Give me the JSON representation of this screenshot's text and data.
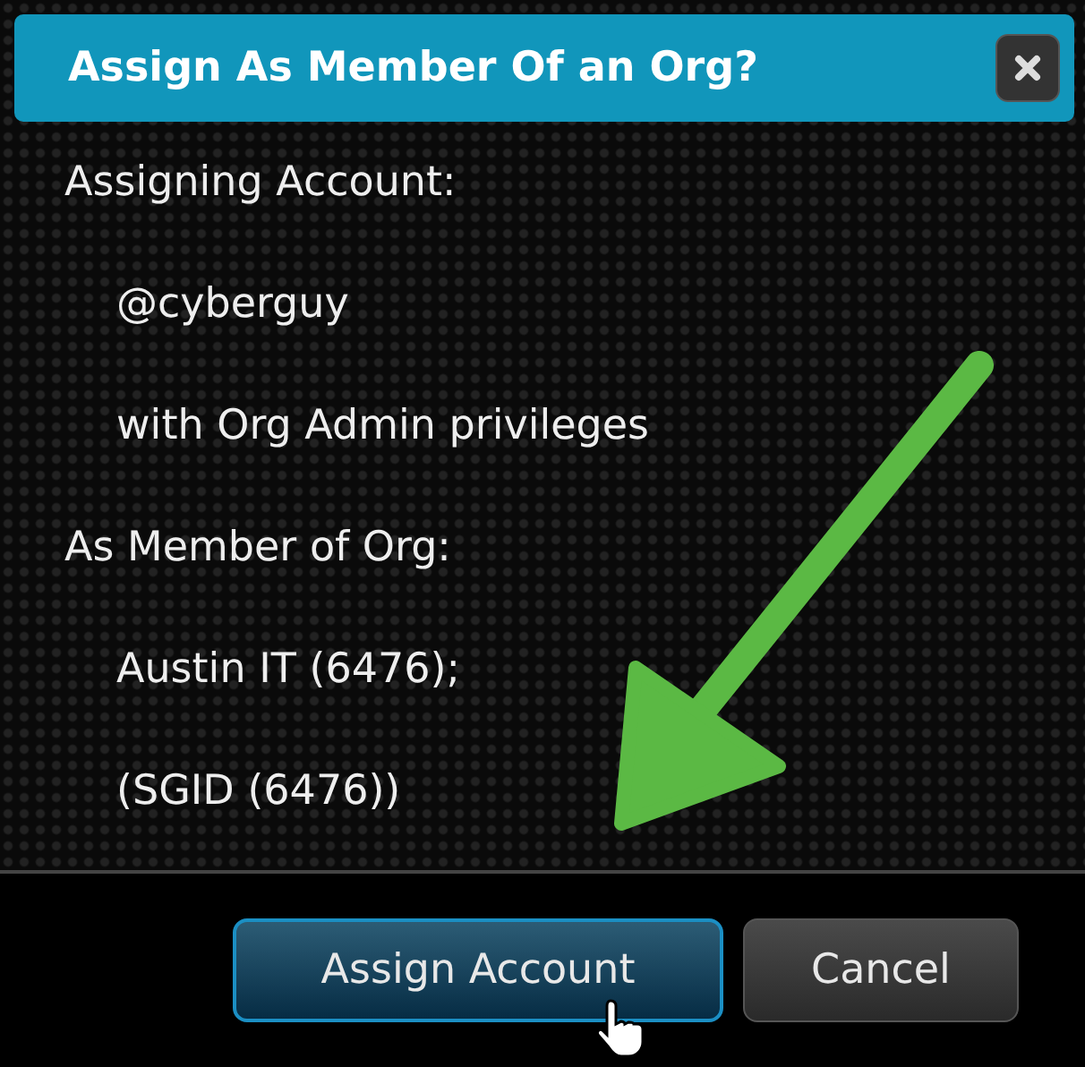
{
  "dialog": {
    "title": "Assign As Member Of an Org?",
    "lines": [
      {
        "text": "Assigning Account:",
        "kind": "label"
      },
      {
        "text": "@cyberguy",
        "kind": "value"
      },
      {
        "text": "with Org Admin privileges",
        "kind": "value"
      },
      {
        "text": "As Member of Org:",
        "kind": "label"
      },
      {
        "text": "Austin IT (6476);",
        "kind": "value"
      },
      {
        "text": "(SGID (6476))",
        "kind": "value"
      }
    ],
    "buttons": [
      {
        "label": "Assign Account",
        "kind": "primary"
      },
      {
        "label": "Cancel",
        "kind": "secondary"
      }
    ]
  }
}
